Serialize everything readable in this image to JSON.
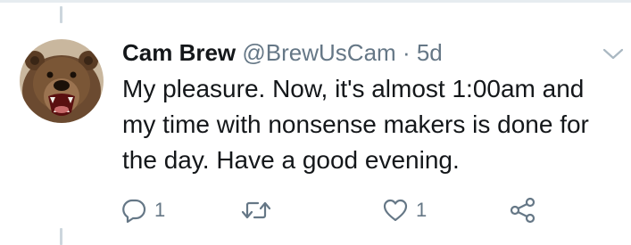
{
  "tweet": {
    "author": {
      "display_name": "Cam Brew",
      "handle": "@BrewUsCam"
    },
    "separator": "·",
    "timestamp": "5d",
    "text": "My pleasure. Now, it's almost 1:00am and my time with nonsense makers is done for the day. Have a good evening.",
    "actions": {
      "reply_count": "1",
      "retweet_count": "",
      "like_count": "1"
    }
  },
  "icons": {
    "avatar": "bear-avatar",
    "caret": "chevron-down-icon",
    "reply": "reply-icon",
    "retweet": "retweet-icon",
    "like": "heart-icon",
    "share": "share-icon"
  },
  "colors": {
    "text": "#14171a",
    "secondary": "#657786",
    "divider": "#e6ecf0",
    "thread_line": "#ccd6dd"
  }
}
